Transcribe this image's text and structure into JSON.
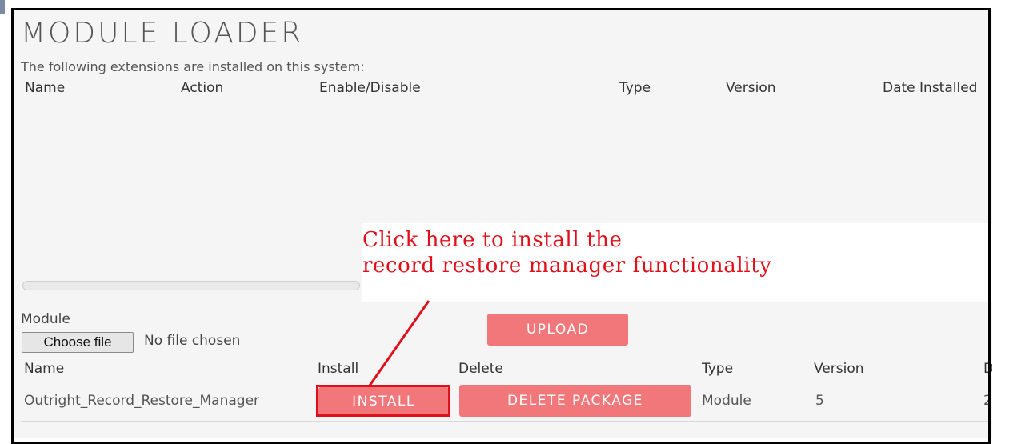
{
  "page": {
    "title": "MODULE LOADER",
    "installed_text": "The following extensions are installed on this system:"
  },
  "installed_table": {
    "headers": [
      "Name",
      "Action",
      "Enable/Disable",
      "Type",
      "Version",
      "Date Installed"
    ]
  },
  "annotation": {
    "line1": "Click here to install the",
    "line2": "record restore manager functionality",
    "color": "#e0101a"
  },
  "upload": {
    "module_label": "Module",
    "choose_file": "Choose file",
    "no_file": "No file chosen",
    "upload_button": "UPLOAD"
  },
  "package_table": {
    "headers": [
      "Name",
      "Install",
      "Delete",
      "Type",
      "Version",
      "Da"
    ],
    "rows": [
      {
        "name": "Outright_Record_Restore_Manager",
        "install": "INSTALL",
        "delete": "DELETE PACKAGE",
        "type": "Module",
        "version": "5",
        "date": "20"
      }
    ]
  },
  "colors": {
    "button": "#f2777a",
    "highlight": "#e0101a",
    "background": "#f5f5f5"
  }
}
